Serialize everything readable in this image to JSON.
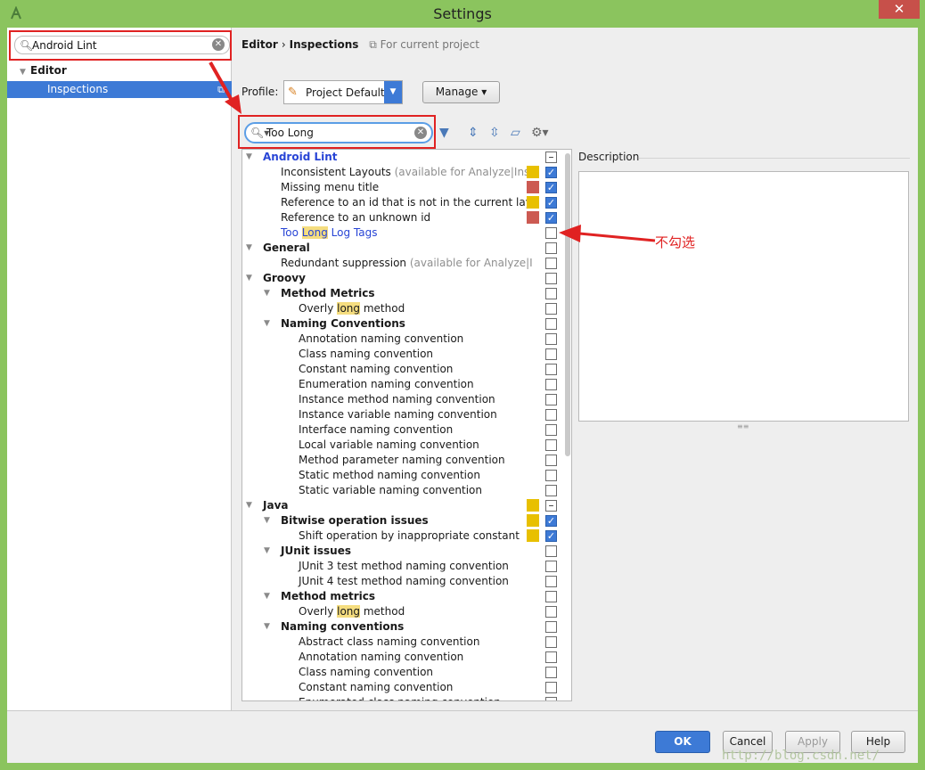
{
  "window": {
    "title": "Settings",
    "close_glyph": "✕"
  },
  "left": {
    "search": {
      "value": "Android Lint"
    },
    "tree": [
      {
        "label": "Editor"
      },
      {
        "label": "Inspections",
        "selected": true
      }
    ]
  },
  "right": {
    "breadcrumb": {
      "part1": "Editor",
      "sep": "›",
      "part2": "Inspections",
      "scope": "For current project"
    },
    "profile": {
      "label": "Profile:",
      "value": "Project Default"
    },
    "manage_label": "Manage ▾",
    "filter": {
      "value": "Too Long"
    },
    "toolbar_icons": [
      "filter-icon",
      "expand-all-icon",
      "collapse-all-icon",
      "reset-icon",
      "settings-icon"
    ],
    "description_title": "Description"
  },
  "tree_rows": [
    {
      "indent": 0,
      "group": true,
      "label": "Android Lint",
      "style": "blue-bold",
      "check": "mixed"
    },
    {
      "indent": 1,
      "label": "Inconsistent Layouts",
      "note": " (available for Analyze|Insp",
      "sev": "#e8c000",
      "check": "checked"
    },
    {
      "indent": 1,
      "label": "Missing menu title",
      "sev": "#cc5a52",
      "check": "checked"
    },
    {
      "indent": 1,
      "label": "Reference to an id that is not in the current layo",
      "sev": "#e8c000",
      "check": "checked"
    },
    {
      "indent": 1,
      "label": "Reference to an unknown id",
      "sev": "#cc5a52",
      "check": "checked"
    },
    {
      "indent": 1,
      "label_pre": "Too ",
      "label_hl": "Long",
      "label_post": " Log Tags",
      "style": "blue",
      "check": "unchecked"
    },
    {
      "indent": 0,
      "group": true,
      "label": "General",
      "style": "bold",
      "check": "unchecked"
    },
    {
      "indent": 1,
      "label": "Redundant suppression",
      "note": " (available for Analyze|I",
      "check": "unchecked"
    },
    {
      "indent": 0,
      "group": true,
      "label": "Groovy",
      "style": "bold",
      "check": "unchecked"
    },
    {
      "indent": 1,
      "group": true,
      "label": "Method Metrics",
      "style": "bold",
      "check": "unchecked"
    },
    {
      "indent": 2,
      "label_pre": "Overly ",
      "label_hl": "long",
      "label_post": " method",
      "check": "unchecked"
    },
    {
      "indent": 1,
      "group": true,
      "label": "Naming Conventions",
      "style": "bold",
      "check": "unchecked"
    },
    {
      "indent": 2,
      "label": "Annotation naming convention",
      "check": "unchecked"
    },
    {
      "indent": 2,
      "label": "Class naming convention",
      "check": "unchecked"
    },
    {
      "indent": 2,
      "label": "Constant naming convention",
      "check": "unchecked"
    },
    {
      "indent": 2,
      "label": "Enumeration naming convention",
      "check": "unchecked"
    },
    {
      "indent": 2,
      "label": "Instance method naming convention",
      "check": "unchecked"
    },
    {
      "indent": 2,
      "label": "Instance variable naming convention",
      "check": "unchecked"
    },
    {
      "indent": 2,
      "label": "Interface naming convention",
      "check": "unchecked"
    },
    {
      "indent": 2,
      "label": "Local variable naming convention",
      "check": "unchecked"
    },
    {
      "indent": 2,
      "label": "Method parameter naming convention",
      "check": "unchecked"
    },
    {
      "indent": 2,
      "label": "Static method naming convention",
      "check": "unchecked"
    },
    {
      "indent": 2,
      "label": "Static variable naming convention",
      "check": "unchecked"
    },
    {
      "indent": 0,
      "group": true,
      "label": "Java",
      "style": "bold",
      "sev": "#e8c000",
      "check": "mixed"
    },
    {
      "indent": 1,
      "group": true,
      "label": "Bitwise operation issues",
      "style": "bold",
      "sev": "#e8c000",
      "check": "checked"
    },
    {
      "indent": 2,
      "label": "Shift operation by inappropriate constant",
      "sev": "#e8c000",
      "check": "checked"
    },
    {
      "indent": 1,
      "group": true,
      "label": "JUnit issues",
      "style": "bold",
      "check": "unchecked"
    },
    {
      "indent": 2,
      "label": "JUnit 3 test method naming convention",
      "check": "unchecked"
    },
    {
      "indent": 2,
      "label": "JUnit 4 test method naming convention",
      "check": "unchecked"
    },
    {
      "indent": 1,
      "group": true,
      "label": "Method metrics",
      "style": "bold",
      "check": "unchecked"
    },
    {
      "indent": 2,
      "label_pre": "Overly ",
      "label_hl": "long",
      "label_post": " method",
      "check": "unchecked"
    },
    {
      "indent": 1,
      "group": true,
      "label": "Naming conventions",
      "style": "bold",
      "check": "unchecked"
    },
    {
      "indent": 2,
      "label": "Abstract class naming convention",
      "check": "unchecked"
    },
    {
      "indent": 2,
      "label": "Annotation naming convention",
      "check": "unchecked"
    },
    {
      "indent": 2,
      "label": "Class naming convention",
      "check": "unchecked"
    },
    {
      "indent": 2,
      "label": "Constant naming convention",
      "check": "unchecked"
    },
    {
      "indent": 2,
      "label": "Enumerated class naming convention",
      "check": "unchecked"
    }
  ],
  "footer": {
    "ok": "OK",
    "cancel": "Cancel",
    "apply": "Apply",
    "help": "Help"
  },
  "annotation": {
    "text": "不勾选",
    "color": "#e02222"
  },
  "watermark": "http://blog.csdn.net/"
}
